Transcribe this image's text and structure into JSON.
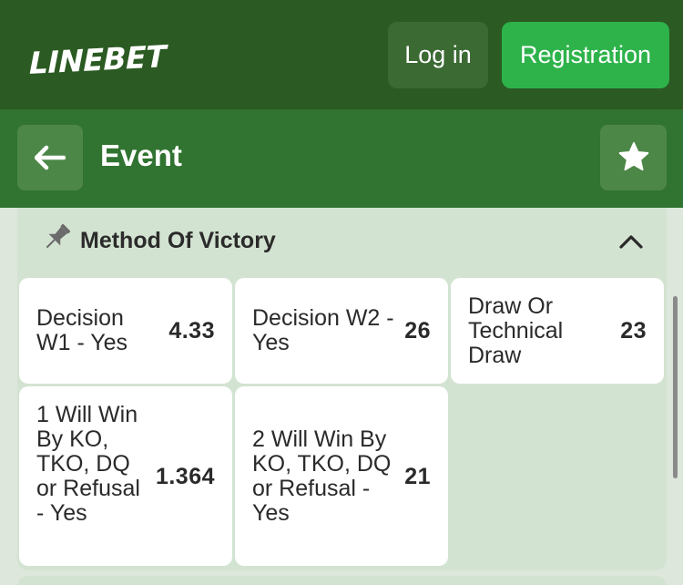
{
  "header": {
    "logo_text": "LINEBET",
    "login_label": "Log in",
    "register_label": "Registration",
    "colors": {
      "topbar": "#2b5a23",
      "register": "#2eb34b"
    }
  },
  "subheader": {
    "title": "Event",
    "back_icon": "arrow-left-icon",
    "favorite_icon": "star-icon"
  },
  "market": {
    "title": "Method Of Victory",
    "pin_icon": "pin-icon",
    "collapse_icon": "chevron-up-icon",
    "outcomes": [
      {
        "label": "Decision W1 - Yes",
        "odd": "4.33"
      },
      {
        "label": "Decision W2 - Yes",
        "odd": "26"
      },
      {
        "label": "Draw Or Technical Draw",
        "odd": "23"
      },
      {
        "label": "1 Will Win By KO, TKO, DQ or Refusal - Yes",
        "odd": "1.364"
      },
      {
        "label": "2 Will Win By KO, TKO, DQ or Refusal - Yes",
        "odd": "21"
      }
    ]
  }
}
